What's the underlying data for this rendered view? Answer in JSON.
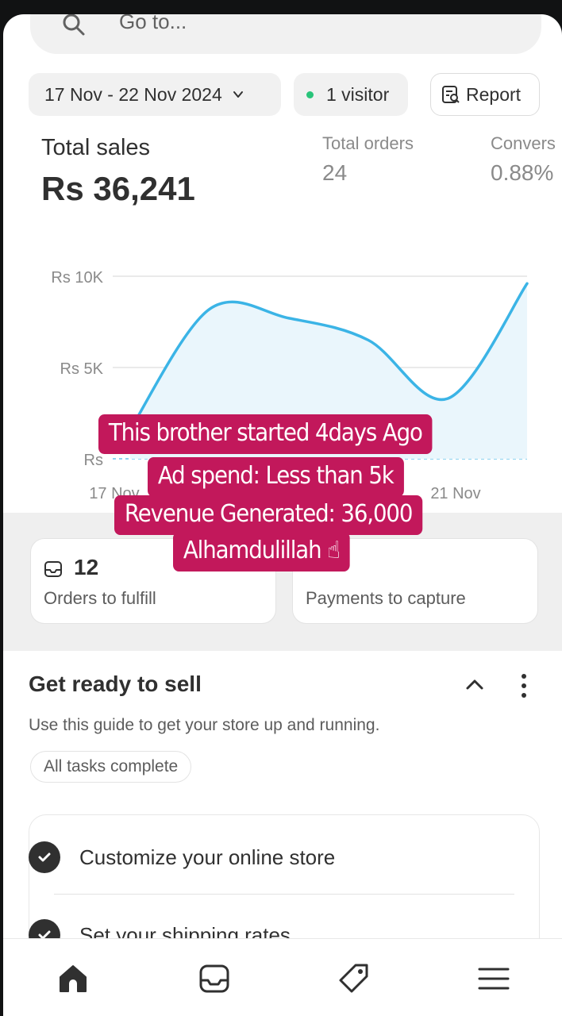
{
  "search": {
    "placeholder": "Go to..."
  },
  "filters": {
    "date_range": "17 Nov - 22 Nov 2024",
    "visitors": "1 visitor",
    "report_label": "Report"
  },
  "metrics": {
    "total_sales_label": "Total sales",
    "total_sales_value": "Rs 36,241",
    "total_orders_label": "Total orders",
    "total_orders_value": "24",
    "conversion_label": "Convers",
    "conversion_value": "0.88%"
  },
  "chart_data": {
    "type": "line",
    "title": "",
    "xlabel": "",
    "ylabel": "",
    "y_tick_labels": [
      "Rs 10K",
      "Rs 5K",
      "Rs"
    ],
    "x_tick_labels": [
      "17 Nov",
      "21 Nov"
    ],
    "ylim": [
      0,
      10000
    ],
    "grid": true,
    "series": [
      {
        "values": [
          {
            "x": "17 Nov",
            "y": 1600
          },
          {
            "x": "18 Nov",
            "y": 8200
          },
          {
            "x": "19 Nov",
            "y": 7700
          },
          {
            "x": "20 Nov",
            "y": 6500
          },
          {
            "x": "21 Nov",
            "y": 3300
          },
          {
            "x": "22 Nov",
            "y": 9600
          }
        ]
      }
    ],
    "colors": {
      "line": "#3bb4e6",
      "fill": "#eaf6fc",
      "comparison": "#8fd3f0"
    }
  },
  "cards": {
    "orders_to_fulfill_count": "12",
    "orders_to_fulfill_label": "Orders to fulfill",
    "payments_to_capture_label": "Payments to capture"
  },
  "setup_guide": {
    "title": "Get ready to sell",
    "description": "Use this guide to get your store up and running.",
    "status_badge": "All tasks complete",
    "tasks": [
      {
        "label": "Customize your online store"
      },
      {
        "label": "Set your shipping rates"
      }
    ]
  },
  "overlay_caption": {
    "line1": "This brother started 4days Ago",
    "line2": "Ad spend: Less than 5k",
    "line3": "Revenue Generated: 36,000",
    "line4": "Alhamdulillah ☝"
  },
  "nav": {
    "icons": [
      "home-icon",
      "orders-icon",
      "products-icon",
      "menu-icon"
    ]
  }
}
